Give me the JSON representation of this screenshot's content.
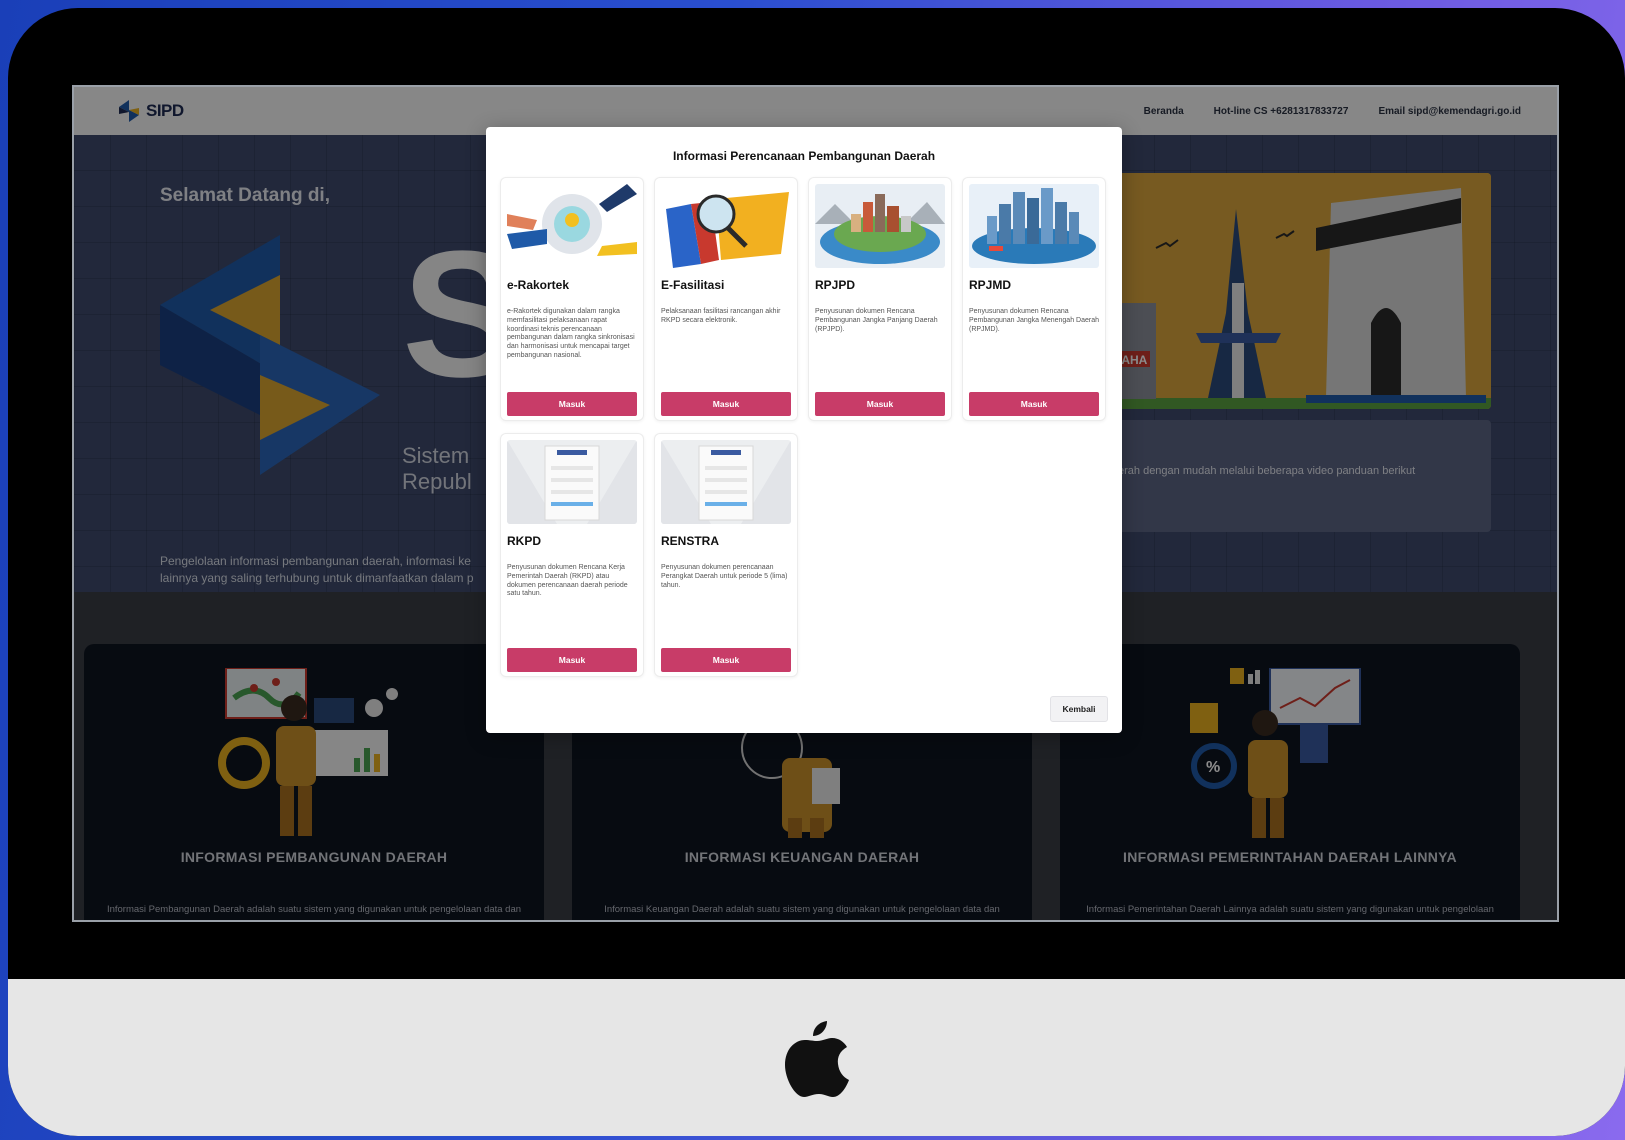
{
  "header": {
    "brand": "SIPD",
    "nav": [
      "Beranda",
      "Hot-line CS +6281317833727",
      "Email sipd@kemendagri.go.id"
    ]
  },
  "hero": {
    "welcome": "Selamat Datang di,",
    "big_letter": "S",
    "system_line1": "Sistem",
    "system_line2": "Republ",
    "description": "Pengelolaan informasi pembangunan daerah, informasi ke lainnya yang saling terhubung untuk dimanfaatkan dalam p",
    "video_text": "erah dengan mudah melalui beberapa video panduan berikut",
    "sign_text": "IAHA"
  },
  "info_cards": [
    {
      "title": "INFORMASI PEMBANGUNAN DAERAH",
      "desc": "Informasi Pembangunan Daerah adalah suatu sistem yang digunakan untuk pengelolaan data dan"
    },
    {
      "title": "INFORMASI KEUANGAN DAERAH",
      "desc": "Informasi Keuangan Daerah adalah suatu sistem yang digunakan untuk pengelolaan data dan"
    },
    {
      "title": "INFORMASI PEMERINTAHAN DAERAH LAINNYA",
      "desc": "Informasi Pemerintahan Daerah Lainnya adalah suatu sistem yang digunakan untuk pengelolaan"
    }
  ],
  "modal": {
    "title": "Informasi Perencanaan Pembangunan Daerah",
    "close_label": "Kembali",
    "cards": [
      {
        "title": "e-Rakortek",
        "desc": "e-Rakortek digunakan dalam rangka memfasilitasi pelaksanaan rapat koordinasi teknis perencanaan pembangunan dalam rangka sinkronisasi dan harmonisasi untuk mencapai target pembangunan nasional.",
        "button": "Masuk"
      },
      {
        "title": "E-Fasilitasi",
        "desc": "Pelaksanaan fasilitasi rancangan akhir RKPD secara elektronik.",
        "button": "Masuk"
      },
      {
        "title": "RPJPD",
        "desc": "Penyusunan dokumen Rencana Pembangunan Jangka Panjang Daerah (RPJPD).",
        "button": "Masuk"
      },
      {
        "title": "RPJMD",
        "desc": "Penyusunan dokumen Rencana Pembangunan Jangka Menengah Daerah (RPJMD).",
        "button": "Masuk"
      },
      {
        "title": "RKPD",
        "desc": "Penyusunan dokumen Rencana Kerja Pemerintah Daerah (RKPD) atau dokumen perencanaan daerah periode satu tahun.",
        "button": "Masuk"
      },
      {
        "title": "RENSTRA",
        "desc": "Penyusunan dokumen perencanaan Perangkat Daerah untuk periode 5 (lima) tahun.",
        "button": "Masuk"
      }
    ]
  },
  "colors": {
    "accent": "#c83c68",
    "brand_navy": "#1e2a52",
    "brand_gold": "#e8b020",
    "brand_blue": "#1f5aa8"
  },
  "icons": [
    "apple-logo-icon",
    "sipd-logo-icon"
  ]
}
